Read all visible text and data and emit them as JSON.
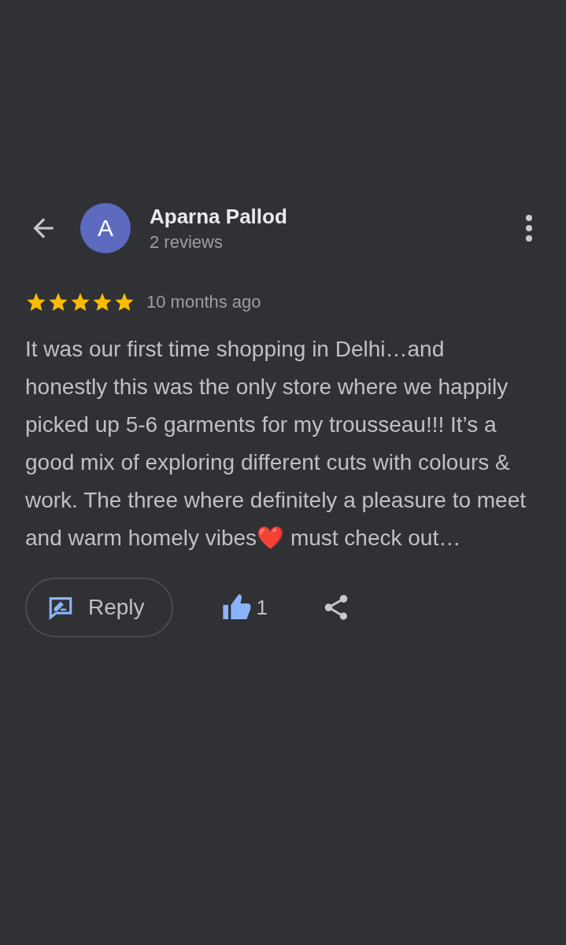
{
  "reviewer": {
    "initial": "A",
    "name": "Aparna Pallod",
    "review_count": "2 reviews"
  },
  "review": {
    "stars": 5,
    "time": "10 months ago",
    "text": "It was our first time shopping in Delhi…and honestly this was the only store where we happily picked up 5-6 garments for my trousseau!!! It’s a good mix of exploring different cuts with colours & work. The three where definitely a pleasure to meet and warm homely vibes❤️ must check out…"
  },
  "actions": {
    "reply_label": "Reply",
    "liked": true,
    "like_count": "1"
  }
}
